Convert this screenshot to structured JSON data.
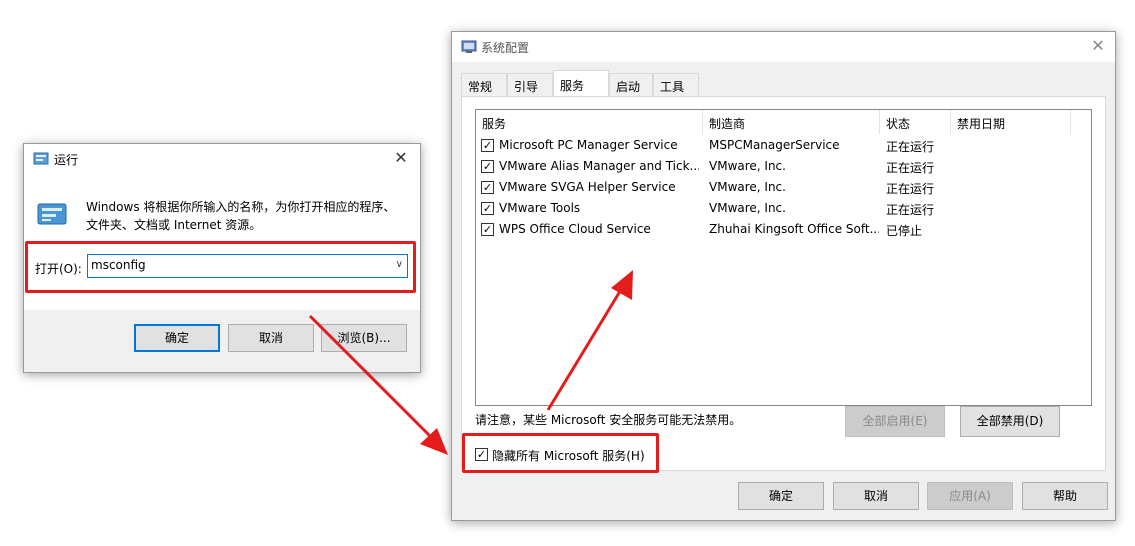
{
  "run_dialog": {
    "title": "运行",
    "description": "Windows 将根据你所输入的名称，为你打开相应的程序、文件夹、文档或 Internet 资源。",
    "open_label": "打开(O):",
    "open_value": "msconfig",
    "buttons": {
      "ok": "确定",
      "cancel": "取消",
      "browse": "浏览(B)..."
    }
  },
  "msconfig": {
    "title": "系统配置",
    "tabs": [
      "常规",
      "引导",
      "服务",
      "启动",
      "工具"
    ],
    "active_tab": "服务",
    "columns": [
      "服务",
      "制造商",
      "状态",
      "禁用日期"
    ],
    "rows": [
      {
        "checked": true,
        "service": "Microsoft PC Manager Service",
        "maker": "MSPCManagerService",
        "status": "正在运行",
        "disabled_date": ""
      },
      {
        "checked": true,
        "service": "VMware Alias Manager and Tick...",
        "maker": "VMware, Inc.",
        "status": "正在运行",
        "disabled_date": ""
      },
      {
        "checked": true,
        "service": "VMware SVGA Helper Service",
        "maker": "VMware, Inc.",
        "status": "正在运行",
        "disabled_date": ""
      },
      {
        "checked": true,
        "service": "VMware Tools",
        "maker": "VMware, Inc.",
        "status": "正在运行",
        "disabled_date": ""
      },
      {
        "checked": true,
        "service": "WPS Office Cloud Service",
        "maker": "Zhuhai Kingsoft Office Soft...",
        "status": "已停止",
        "disabled_date": ""
      }
    ],
    "notice": "请注意，某些 Microsoft 安全服务可能无法禁用。",
    "enable_all": "全部启用(E)",
    "disable_all": "全部禁用(D)",
    "hide_ms_label": "隐藏所有 Microsoft 服务(H)",
    "hide_ms_checked": true,
    "buttons": {
      "ok": "确定",
      "cancel": "取消",
      "apply": "应用(A)",
      "help": "帮助"
    }
  },
  "colors": {
    "highlight": "#e51c1c",
    "focus": "#0078d7"
  }
}
